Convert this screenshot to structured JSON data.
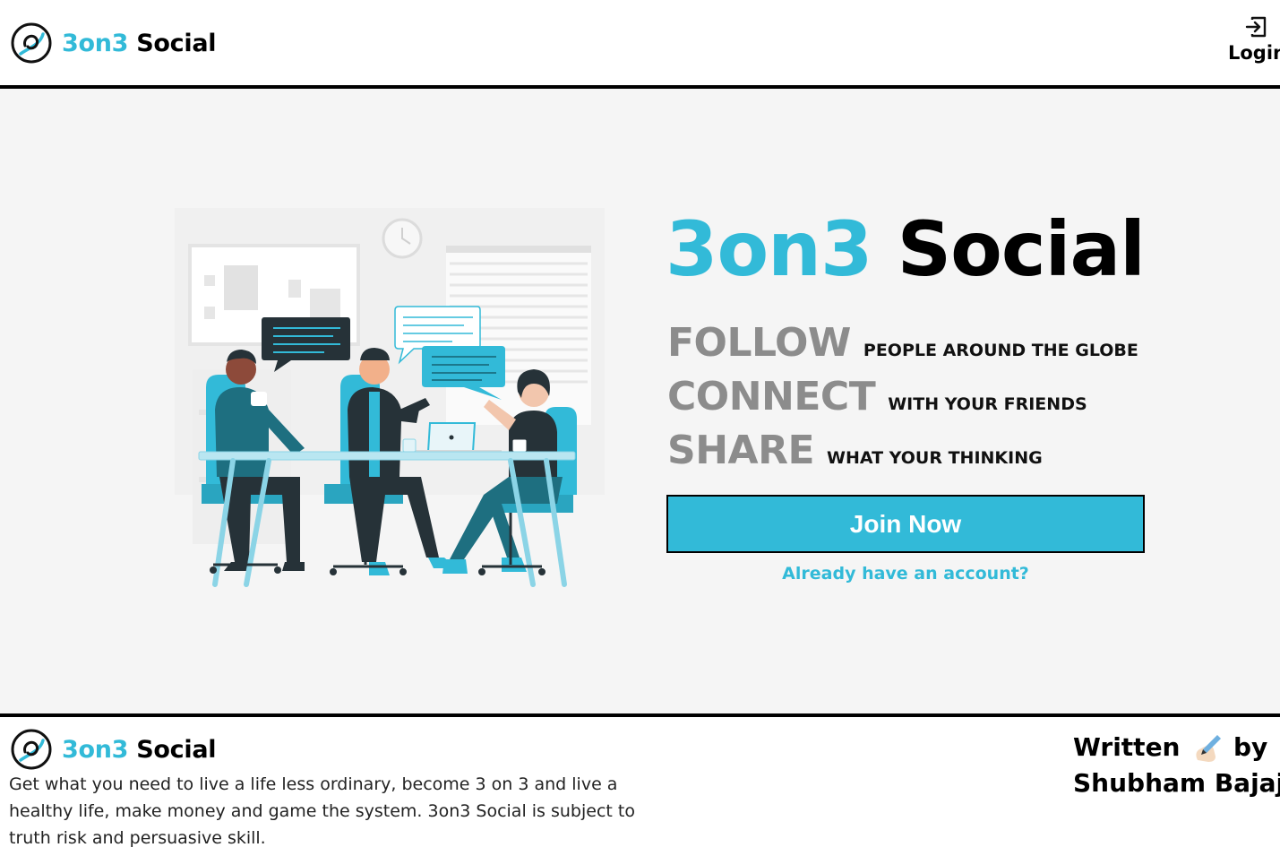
{
  "header": {
    "brand_accent": "3on3",
    "brand_rest": "Social",
    "login_label": "Login",
    "login_icon": "login-icon"
  },
  "hero": {
    "title_accent": "3on3",
    "title_rest": "Social",
    "taglines": [
      {
        "big": "FOLLOW",
        "small": "PEOPLE AROUND THE GLOBE"
      },
      {
        "big": "CONNECT",
        "small": "WITH YOUR FRIENDS"
      },
      {
        "big": "SHARE",
        "small": "WHAT YOUR THINKING"
      }
    ],
    "join_button": "Join Now",
    "have_account": "Already have an account?"
  },
  "footer": {
    "brand_accent": "3on3",
    "brand_rest": "Social",
    "description": "Get what you need to live a life less ordinary, become 3 on 3 and live a healthy life, make money and game the system. 3on3 Social is subject to truth risk and persuasive skill.",
    "credit_line1_a": "Written",
    "credit_line1_b": "by",
    "credit_line2": "Shubham Bajaj"
  },
  "colors": {
    "accent": "#32bad8",
    "hero_background": "#f5f5f5",
    "tagline_gray": "#8c8c8c"
  }
}
